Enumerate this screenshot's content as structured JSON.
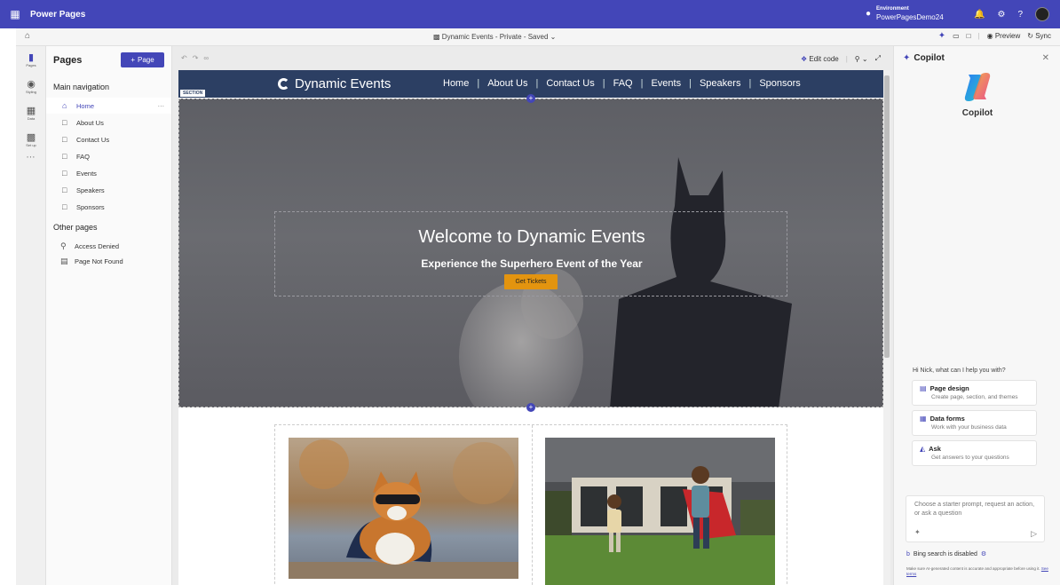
{
  "topbar": {
    "app_name": "Power Pages",
    "environment_label": "Environment",
    "environment_value": "PowerPagesDemo24"
  },
  "subbar": {
    "site_title": "Dynamic Events - Private - Saved",
    "preview_label": "Preview",
    "sync_label": "Sync"
  },
  "rail": {
    "items": [
      {
        "label": "Pages"
      },
      {
        "label": "Styling"
      },
      {
        "label": "Data"
      },
      {
        "label": "Set up"
      }
    ]
  },
  "pages_panel": {
    "title": "Pages",
    "add_label": "Page",
    "main_nav_heading": "Main navigation",
    "main_nav": [
      {
        "label": "Home"
      },
      {
        "label": "About Us"
      },
      {
        "label": "Contact Us"
      },
      {
        "label": "FAQ"
      },
      {
        "label": "Events"
      },
      {
        "label": "Speakers"
      },
      {
        "label": "Sponsors"
      }
    ],
    "other_heading": "Other pages",
    "other_pages": [
      {
        "label": "Access Denied"
      },
      {
        "label": "Page Not Found"
      }
    ]
  },
  "canvas": {
    "edit_code_label": "Edit code"
  },
  "site": {
    "name": "Dynamic Events",
    "nav": [
      "Home",
      "About Us",
      "Contact Us",
      "FAQ",
      "Events",
      "Speakers",
      "Sponsors"
    ],
    "section_tag": "SECTION",
    "hero_title": "Welcome to Dynamic Events",
    "hero_subtitle": "Experience the Superhero Event of the Year",
    "hero_button": "Get Tickets"
  },
  "copilot": {
    "title": "Copilot",
    "name": "Copilot",
    "greeting": "Hi Nick, what can I help you with?",
    "cards": [
      {
        "title": "Page design",
        "desc": "Create page, section, and themes"
      },
      {
        "title": "Data forms",
        "desc": "Work with your business data"
      },
      {
        "title": "Ask",
        "desc": "Get answers to your questions"
      }
    ],
    "input_placeholder": "Choose a starter prompt, request an action, or ask a question",
    "bing_status": "Bing search is disabled",
    "disclaimer": "Make sure AI-generated content is accurate and appropriate before using it.",
    "disclaimer_link": "See terms"
  },
  "colors": {
    "brand": "#4346b8",
    "site_nav": "#2c3f63",
    "hero_button": "#e3940f"
  }
}
